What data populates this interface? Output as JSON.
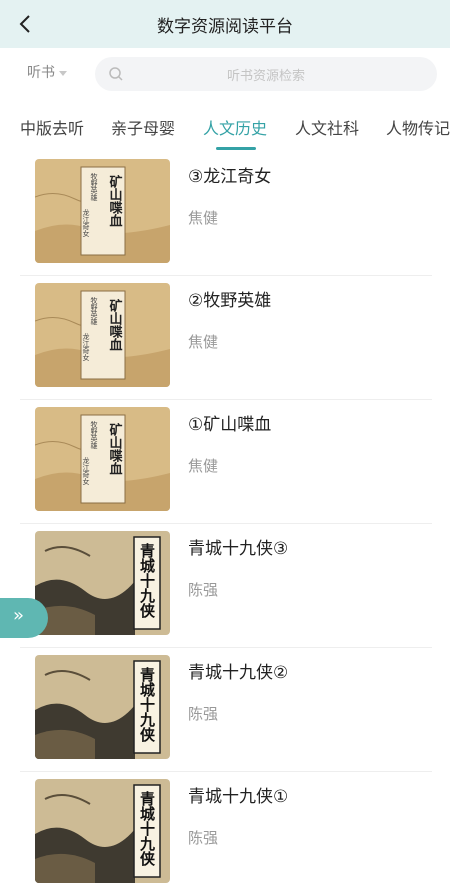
{
  "header": {
    "title": "数字资源阅读平台"
  },
  "search": {
    "filter_label": "听书",
    "placeholder": "听书资源检索"
  },
  "tabs": [
    {
      "label": "中版去听",
      "active": false
    },
    {
      "label": "亲子母婴",
      "active": false
    },
    {
      "label": "人文历史",
      "active": true
    },
    {
      "label": "人文社科",
      "active": false
    },
    {
      "label": "人物传记",
      "active": false
    }
  ],
  "cover_texts": {
    "kuangshan": {
      "main": "矿山喋血",
      "side1": "牧野英雄",
      "side2": "龙江奇女"
    },
    "qingcheng": {
      "main": "青城十九侠"
    }
  },
  "books": [
    {
      "title": "③龙江奇女",
      "author": "焦健",
      "cover": "kuangshan"
    },
    {
      "title": "②牧野英雄",
      "author": "焦健",
      "cover": "kuangshan"
    },
    {
      "title": "①矿山喋血",
      "author": "焦健",
      "cover": "kuangshan"
    },
    {
      "title": "青城十九侠③",
      "author": "陈强",
      "cover": "qingcheng"
    },
    {
      "title": "青城十九侠②",
      "author": "陈强",
      "cover": "qingcheng"
    },
    {
      "title": "青城十九侠①",
      "author": "陈强",
      "cover": "qingcheng"
    }
  ],
  "icons": {
    "back": "chevron-left-icon",
    "search": "search-icon",
    "dropdown": "caret-down-icon",
    "expand": "double-chevron-right-icon"
  },
  "colors": {
    "accent": "#34a2a6",
    "header_bg": "#e4f2f2",
    "side_button": "#5fb7b2"
  }
}
